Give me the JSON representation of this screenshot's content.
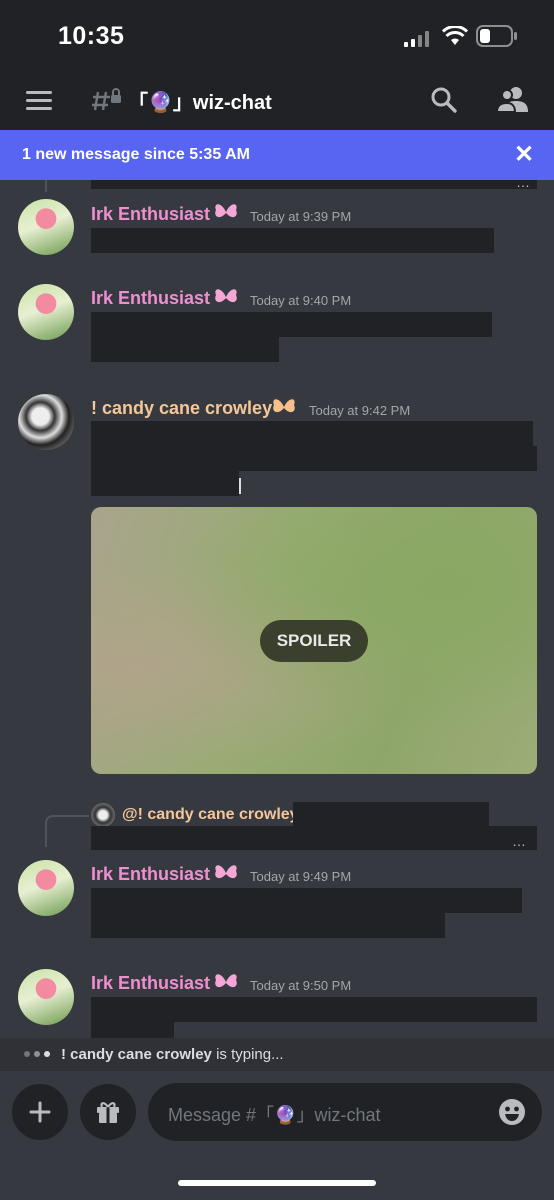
{
  "status": {
    "time": "10:35"
  },
  "header": {
    "channel_name": "「🔮」wiz-chat"
  },
  "banner": {
    "text": "1 new message since 5:35 AM"
  },
  "messages": [
    {
      "author": "Irk Enthusiast",
      "time": "Today at 9:39 PM"
    },
    {
      "author": "Irk Enthusiast",
      "time": "Today at 9:40 PM"
    },
    {
      "author": "! candy cane crowley",
      "time": "Today at 9:42 PM",
      "spoiler_label": "SPOILER"
    },
    {
      "reply_to": "@! candy cane crowley",
      "author": "Irk Enthusiast",
      "time": "Today at 9:49 PM"
    },
    {
      "author": "Irk Enthusiast",
      "time": "Today at 9:50 PM"
    }
  ],
  "typing": {
    "user": "! candy cane crowley",
    "suffix": " is typing..."
  },
  "composer": {
    "placeholder": "Message #「🔮」wiz-chat"
  },
  "colors": {
    "blurple": "#5865f2",
    "name_pink": "#ee8fd0",
    "name_peach": "#f4c79a"
  },
  "icons": [
    "signal-icon",
    "wifi-icon",
    "battery-icon",
    "hamburger-icon",
    "channel-hash-lock-icon",
    "search-icon",
    "members-icon",
    "close-icon",
    "butterfly-badge-icon",
    "plus-icon",
    "gift-icon",
    "emoji-icon"
  ]
}
